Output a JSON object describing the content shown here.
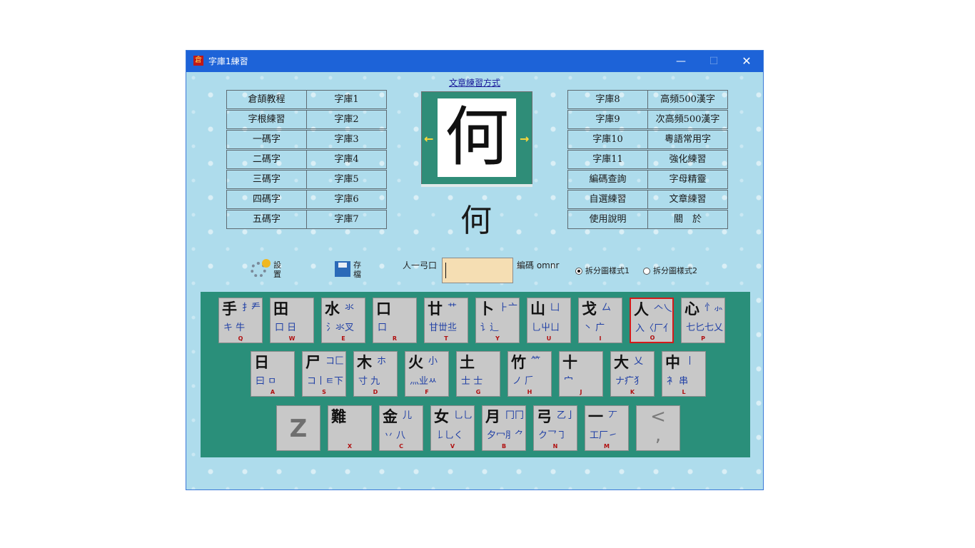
{
  "window": {
    "title": "字庫1練習",
    "icon": "倉",
    "controls": [
      "—",
      "☐",
      "✕"
    ]
  },
  "link": "文章練習方式",
  "left_menu": [
    [
      "倉頡教程",
      "字庫1"
    ],
    [
      "字根練習",
      "字庫2"
    ],
    [
      "一碼字",
      "字庫3"
    ],
    [
      "二碼字",
      "字庫4"
    ],
    [
      "三碼字",
      "字庫5"
    ],
    [
      "四碼字",
      "字庫6"
    ],
    [
      "五碼字",
      "字庫7"
    ]
  ],
  "right_menu": [
    [
      "字庫8",
      "高頻500漢字"
    ],
    [
      "字庫9",
      "次高頻500漢字"
    ],
    [
      "字庫10",
      "粵語常用字"
    ],
    [
      "字庫11",
      "強化練習"
    ],
    [
      "編碼查詢",
      "字母精靈"
    ],
    [
      "自選練習",
      "文章練習"
    ],
    [
      "使用說明",
      "關　於"
    ]
  ],
  "viewer": {
    "char": "何",
    "prev": "←",
    "next": "→"
  },
  "current_char": "何",
  "toolbar": {
    "settings_a": "設",
    "settings_b": "置",
    "save_a": "存",
    "save_b": "檔"
  },
  "code": {
    "label": "人一弓口",
    "value": "",
    "info": "編碼 omnr"
  },
  "radios": [
    {
      "label": "拆分圖樣式1",
      "checked": true
    },
    {
      "label": "拆分圖樣式2",
      "checked": false
    }
  ],
  "keyboard": {
    "row1": [
      {
        "main": "手",
        "parts": "扌龵",
        "sub": "キ 牛",
        "letter": "Q"
      },
      {
        "main": "田",
        "parts": "",
        "sub": "口 日",
        "letter": "W"
      },
      {
        "main": "水",
        "parts": "氺",
        "sub": "氵氺叉",
        "letter": "E"
      },
      {
        "main": "口",
        "parts": "",
        "sub": "   口",
        "letter": "R"
      },
      {
        "main": "廿",
        "parts": "艹",
        "sub": "甘丗丠",
        "letter": "T"
      },
      {
        "main": "卜",
        "parts": "⺊亠",
        "sub": "讠辶",
        "letter": "Y"
      },
      {
        "main": "山",
        "parts": "凵",
        "sub": "乚屮ㄩ",
        "letter": "U"
      },
      {
        "main": "戈",
        "parts": "厶",
        "sub": "丶 广",
        "letter": "I"
      },
      {
        "main": "人",
        "parts": "𠆢乀",
        "sub": "入〈厂亻",
        "letter": "O"
      },
      {
        "main": "心",
        "parts": "忄⺗",
        "sub": "七匕七乂",
        "letter": "P"
      }
    ],
    "row2": [
      {
        "main": "日",
        "parts": "",
        "sub": "曰 ㅁ",
        "letter": "A"
      },
      {
        "main": "尸",
        "parts": "コ匚",
        "sub": "コ丨ㅌ下",
        "letter": "S"
      },
      {
        "main": "木",
        "parts": "ホ",
        "sub": "寸 九",
        "letter": "D"
      },
      {
        "main": "火",
        "parts": "小",
        "sub": "灬业ㅆ",
        "letter": "F"
      },
      {
        "main": "土",
        "parts": "",
        "sub": "士 士",
        "letter": "G"
      },
      {
        "main": "竹",
        "parts": "⺮",
        "sub": "ノ 𠂆",
        "letter": "H"
      },
      {
        "main": "十",
        "parts": "",
        "sub": "    宀",
        "letter": "J"
      },
      {
        "main": "大",
        "parts": "乂",
        "sub": "ナ疒犭",
        "letter": "K"
      },
      {
        "main": "中",
        "parts": "丨",
        "sub": "衤 串",
        "letter": "L"
      }
    ],
    "row3": [
      {
        "main": "難",
        "parts": "",
        "sub": "",
        "letter": "X"
      },
      {
        "main": "金",
        "parts": "儿",
        "sub": "丷 八",
        "letter": "C"
      },
      {
        "main": "女",
        "parts": "乚乚",
        "sub": "𠄌乚く",
        "letter": "V"
      },
      {
        "main": "月",
        "parts": "冂冂",
        "sub": "夕冖⺼⺈",
        "letter": "B"
      },
      {
        "main": "弓",
        "parts": "乙亅",
        "sub": "ク乛㇆",
        "letter": "N"
      },
      {
        "main": "一",
        "parts": "丆",
        "sub": "工厂㇀",
        "letter": "M"
      }
    ],
    "z_key": "Z",
    "comma_top": "<",
    "comma_bottom": ","
  }
}
